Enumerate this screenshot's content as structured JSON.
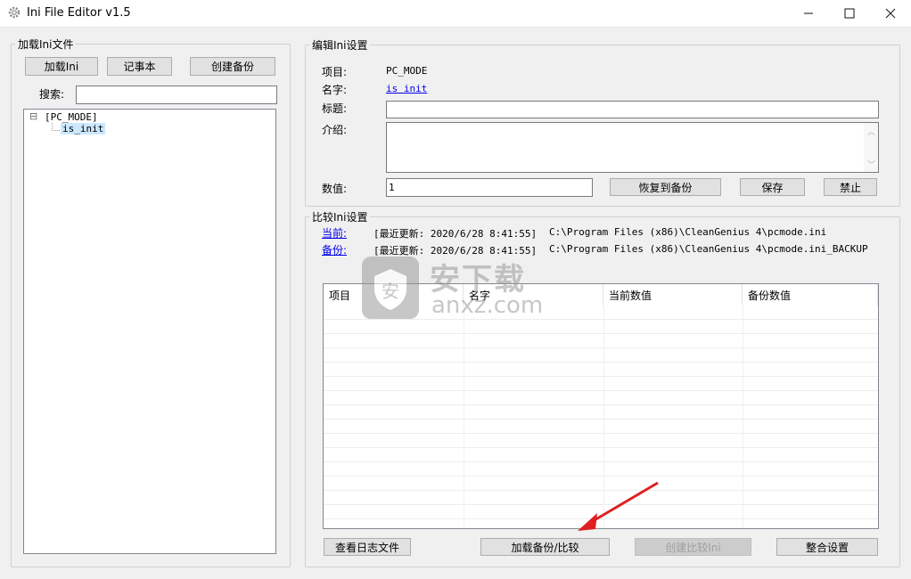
{
  "window": {
    "title": "Ini File Editor v1.5",
    "controls": [
      "—",
      "☐",
      "✕"
    ]
  },
  "load_panel": {
    "legend": "加载Ini文件",
    "buttons": {
      "load_ini": "加载Ini",
      "notepad": "记事本",
      "create_backup": "创建备份"
    },
    "search_label": "搜索:",
    "search_value": "",
    "tree": {
      "root": "[PC_MODE]",
      "child": "is_init",
      "expander": "⊟"
    }
  },
  "edit_panel": {
    "legend": "编辑Ini设置",
    "item_label": "项目:",
    "item_value": "PC_MODE",
    "name_label": "名字:",
    "name_value": "is init",
    "title_label": "标题:",
    "title_value": "",
    "desc_label": "介绍:",
    "desc_value": "",
    "value_label": "数值:",
    "value_value": "1",
    "buttons": {
      "restore": "恢复到备份",
      "save": "保存",
      "disable": "禁止"
    }
  },
  "compare_panel": {
    "legend": "比较Ini设置",
    "current_label": "当前:",
    "current_update": "[最近更新: 2020/6/28 8:41:55]",
    "current_path": "C:\\Program Files (x86)\\CleanGenius 4\\pcmode.ini",
    "backup_label": "备份:",
    "backup_update": "[最近更新: 2020/6/28 8:41:55]",
    "backup_path": "C:\\Program Files (x86)\\CleanGenius 4\\pcmode.ini_BACKUP",
    "columns": [
      "项目",
      "名字",
      "当前数值",
      "备份数值"
    ],
    "buttons": {
      "view_log": "查看日志文件",
      "load_compare": "加载备份/比较",
      "create_compare": "创建比较Ini",
      "merge": "整合设置"
    }
  },
  "watermark": {
    "text1": "安下载",
    "text2": "anxz.com"
  },
  "colors": {
    "link": "#0000ee",
    "selected": "#cce8ff",
    "arrow": "#e02020"
  }
}
